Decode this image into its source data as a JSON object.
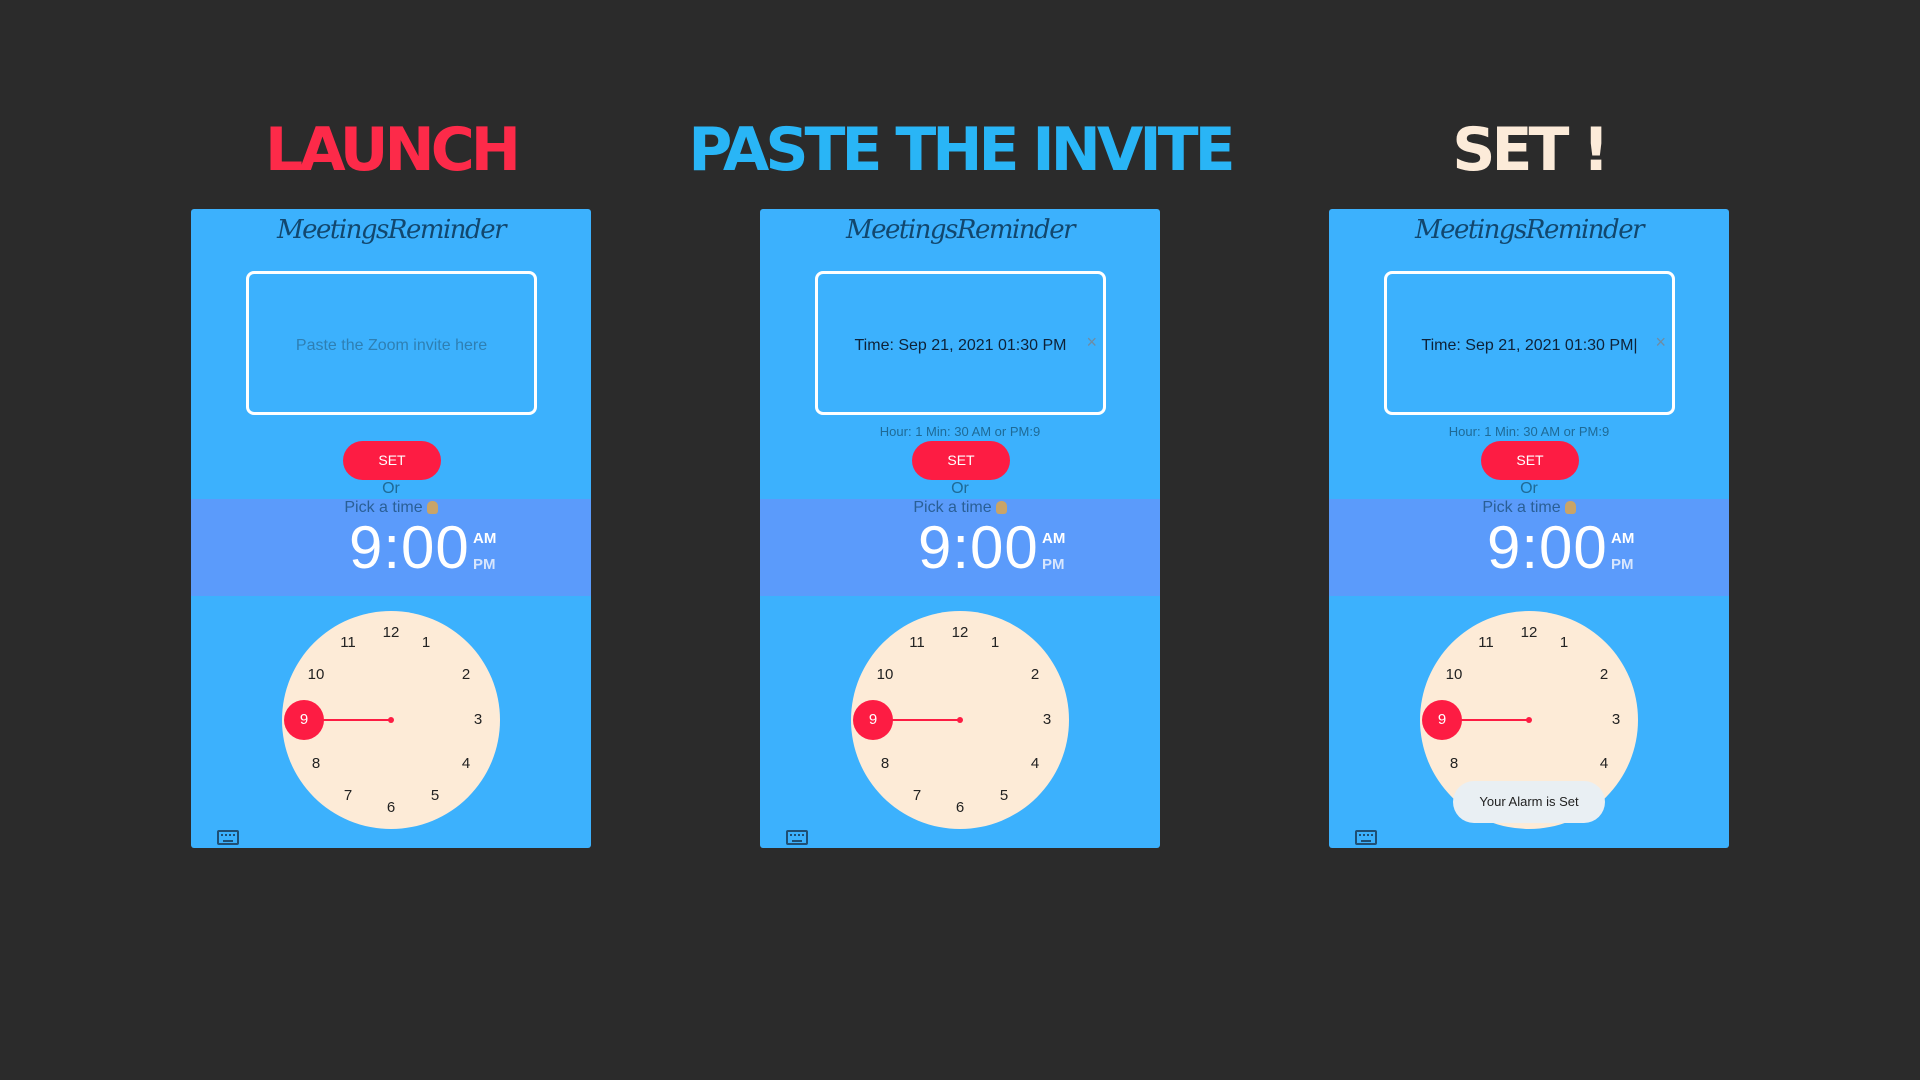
{
  "colors": {
    "background": "#2b2b2b",
    "phone_bg": "#3cb1fd",
    "time_band": "#5b9bfb",
    "accent_red": "#fd1c43",
    "clock_face": "#fdebd7"
  },
  "steps": [
    {
      "heading": "LAUNCH",
      "heading_color": "#fd2a49",
      "app_title": "MeetingsReminder",
      "invite_placeholder": "Paste the Zoom invite here",
      "invite_value": "",
      "set_label": "SET",
      "or_label": "Or",
      "pick_label": "Pick a time",
      "time": "9:00",
      "am": "AM",
      "pm": "PM"
    },
    {
      "heading": "PASTE THE INVITE",
      "heading_color": "#29b5f6",
      "app_title": "MeetingsReminder",
      "invite_value": "Time: Sep 21, 2021 01:30 PM",
      "clear_icon": "×",
      "helper": "Hour: 1 Min: 30 AM or PM:9",
      "set_label": "SET",
      "or_label": "Or",
      "pick_label": "Pick a time",
      "time": "9:00",
      "am": "AM",
      "pm": "PM"
    },
    {
      "heading": "SET !",
      "heading_color": "#fcebd9",
      "app_title": "MeetingsReminder",
      "invite_value": "Time: Sep 21, 2021 01:30 PM|",
      "clear_icon": "×",
      "helper": "Hour: 1 Min: 30 AM or PM:9",
      "set_label": "SET",
      "or_label": "Or",
      "pick_label": "Pick a time",
      "time": "9:00",
      "am": "AM",
      "pm": "PM",
      "toast": "Your Alarm is Set"
    }
  ],
  "clock": {
    "numbers": [
      "12",
      "1",
      "2",
      "3",
      "4",
      "5",
      "6",
      "7",
      "8",
      "9",
      "10",
      "11"
    ],
    "selected": "9"
  },
  "icons": {
    "hand": "pointing-hand-icon",
    "keyboard": "keyboard-icon",
    "clear": "close-icon"
  }
}
